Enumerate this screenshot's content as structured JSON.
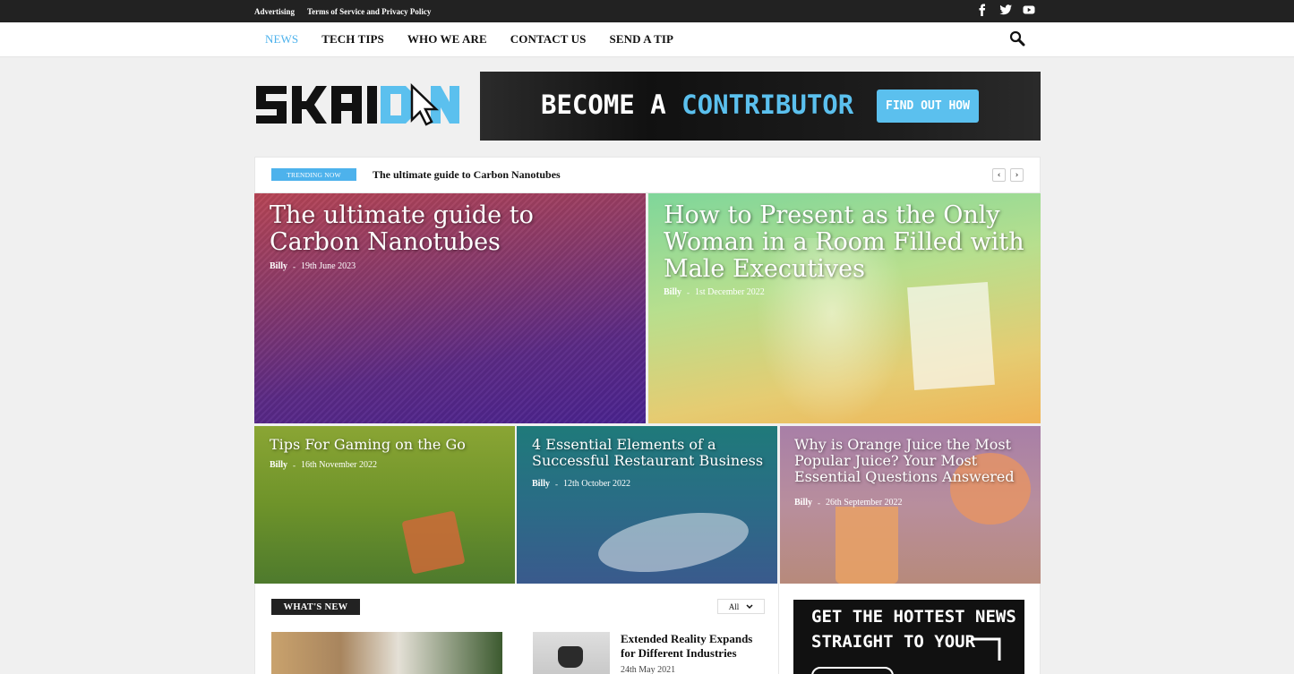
{
  "topbar": {
    "links": [
      "Advertising",
      "Terms of Service and Privacy Policy"
    ],
    "social": [
      "facebook-icon",
      "twitter-icon",
      "youtube-icon"
    ]
  },
  "nav": {
    "items": [
      {
        "label": "NEWS",
        "active": true
      },
      {
        "label": "TECH TIPS",
        "active": false
      },
      {
        "label": "WHO WE ARE",
        "active": false
      },
      {
        "label": "CONTACT US",
        "active": false
      },
      {
        "label": "SEND A TIP",
        "active": false
      }
    ],
    "search_icon": "search-icon"
  },
  "logo": {
    "text_dark": "SKAI",
    "text_blue": "DON"
  },
  "banner": {
    "prefix": "BECOME A",
    "highlight": "CONTRIBUTOR",
    "cta": "FIND OUT HOW"
  },
  "trending": {
    "badge": "TRENDING NOW",
    "title": "The ultimate guide to Carbon Nanotubes",
    "prev_icon": "chevron-left-icon",
    "next_icon": "chevron-right-icon"
  },
  "featured": [
    {
      "title": "The ultimate guide to Carbon Nanotubes",
      "author": "Billy",
      "date": "19th June 2023"
    },
    {
      "title": "How to Present as the Only Woman in a Room Filled with Male Executives",
      "author": "Billy",
      "date": "1st December 2022"
    },
    {
      "title": "Tips For Gaming on the Go",
      "author": "Billy",
      "date": "16th November 2022"
    },
    {
      "title": "4 Essential Elements of a Successful Restaurant Business",
      "author": "Billy",
      "date": "12th October 2022"
    },
    {
      "title": "Why is Orange Juice the Most Popular Juice? Your Most Essential Questions Answered",
      "author": "Billy",
      "date": "26th September 2022"
    }
  ],
  "meta_separator": "-",
  "whats_new": {
    "heading": "WHAT'S NEW",
    "filter": "All",
    "posts": [
      {
        "title": "Extended Reality Expands for Different Industries",
        "date": "24th May 2021"
      }
    ]
  },
  "promo": {
    "line1": "GET THE HOTTEST NEWS",
    "line2": "STRAIGHT TO YOUR"
  },
  "colors": {
    "accent": "#4db2ec",
    "topbar": "#222222",
    "banner_highlight": "#5bc0ee"
  }
}
